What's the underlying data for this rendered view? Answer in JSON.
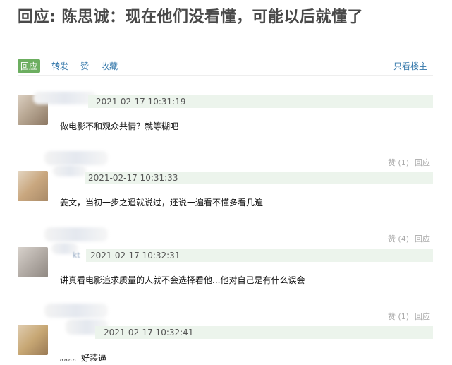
{
  "page": {
    "title": "回应: 陈思诚：现在他们没看懂，可能以后就懂了"
  },
  "toolbar": {
    "tabs": [
      {
        "label": "回应",
        "active": true
      },
      {
        "label": "转发",
        "active": false
      },
      {
        "label": "赞",
        "active": false
      },
      {
        "label": "收藏",
        "active": false
      }
    ],
    "only_op": "只看楼主"
  },
  "comments": [
    {
      "name_fragment": "",
      "time": "2021-02-17 10:31:19",
      "content": "做电影不和观众共情？就等糊吧",
      "like_label": "",
      "reply_label": ""
    },
    {
      "name_fragment": "",
      "time": "2021-02-17 10:31:33",
      "content": "姜文，当初一步之遥就说过，还说一遍看不懂多看几遍",
      "like_label": "赞 (1)",
      "reply_label": "回应"
    },
    {
      "name_fragment": "kt",
      "time": "2021-02-17 10:32:31",
      "content": "讲真看电影追求质量的人就不会选择看他...他对自己是有什么误会",
      "like_label": "赞 (4)",
      "reply_label": "回应"
    },
    {
      "name_fragment": "",
      "time": "2021-02-17 10:32:41",
      "content": "。。。。好装逼",
      "like_label": "赞 (1)",
      "reply_label": "回应"
    }
  ],
  "colors": {
    "accent": "#6cae60",
    "link": "#3377aa",
    "meta_bar": "#ecf4ec"
  }
}
